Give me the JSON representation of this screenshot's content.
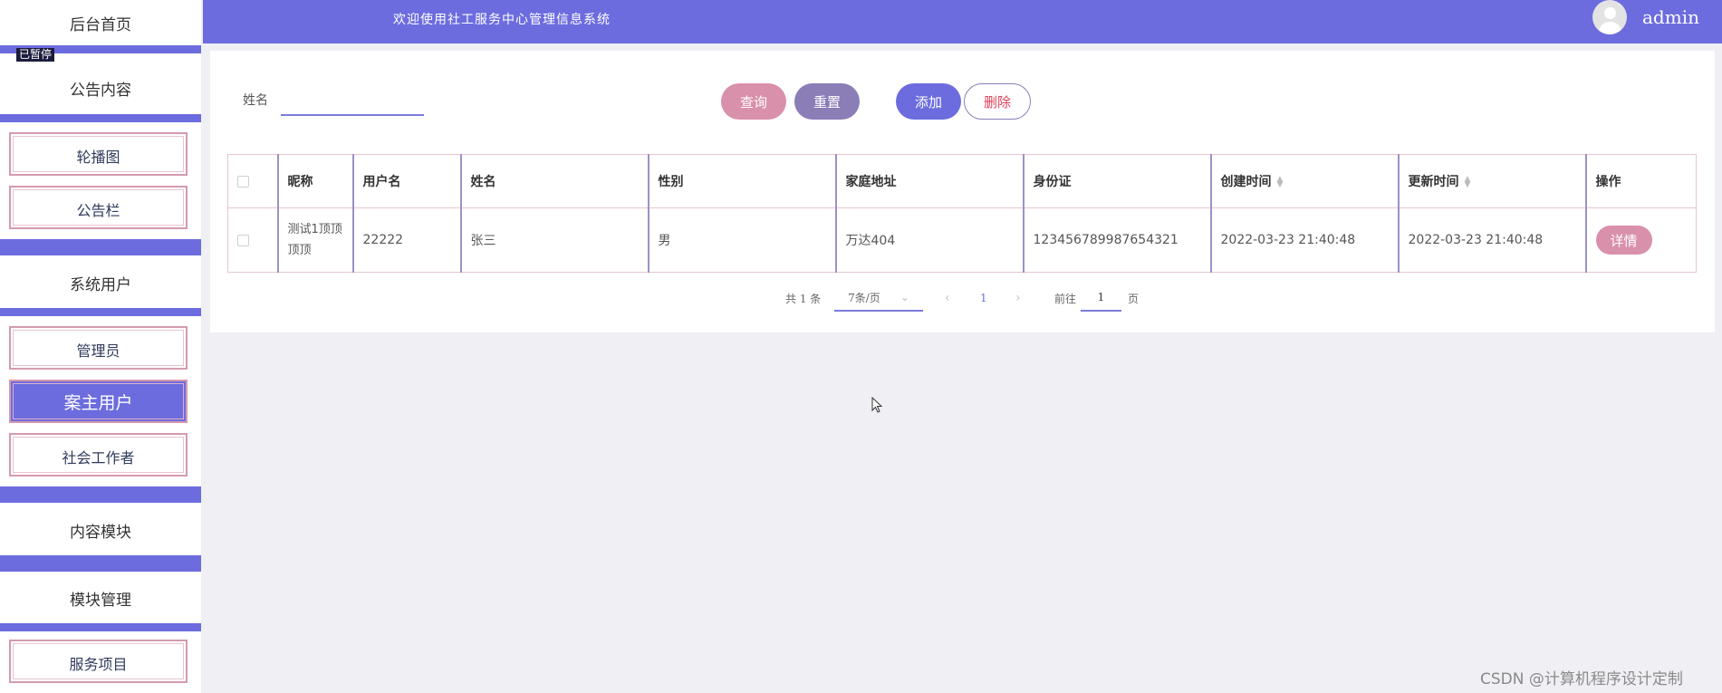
{
  "sidebar": {
    "home": "后台首页",
    "paused": "已暂停",
    "groups": [
      {
        "title": "公告内容",
        "items": [
          "轮播图",
          "公告栏"
        ]
      },
      {
        "title": "系统用户",
        "items": [
          "管理员",
          "案主用户",
          "社会工作者"
        ]
      },
      {
        "title": "内容模块",
        "items": []
      },
      {
        "title": "模块管理",
        "items": [
          "服务项目"
        ]
      }
    ],
    "active_item": "案主用户"
  },
  "header": {
    "title": "欢迎使用社工服务中心管理信息系统",
    "user": "admin",
    "avatar_icon": "user-avatar-icon"
  },
  "search": {
    "label": "姓名",
    "value": ""
  },
  "buttons": {
    "query": "查询",
    "reset": "重置",
    "add": "添加",
    "delete": "删除"
  },
  "table": {
    "columns": [
      "",
      "昵称",
      "用户名",
      "姓名",
      "性别",
      "家庭地址",
      "身份证",
      "创建时间",
      "更新时间",
      "操作"
    ],
    "rows": [
      {
        "nickname": "测试1顶顶顶顶",
        "username": "22222",
        "name": "张三",
        "gender": "男",
        "address": "万达404",
        "id_card": "123456789987654321",
        "created": "2022-03-23 21:40:48",
        "updated": "2022-03-23 21:40:48",
        "action": "详情"
      }
    ]
  },
  "pagination": {
    "total": "共 1 条",
    "page_size": "7条/页",
    "current_page": "1",
    "goto_label": "前往",
    "goto_value": "1",
    "page_suffix": "页"
  },
  "watermark": "CSDN @计算机程序设计定制",
  "colors": {
    "accent": "#6c6cdf",
    "pink": "#d990aa",
    "purple": "#8b7db6"
  }
}
